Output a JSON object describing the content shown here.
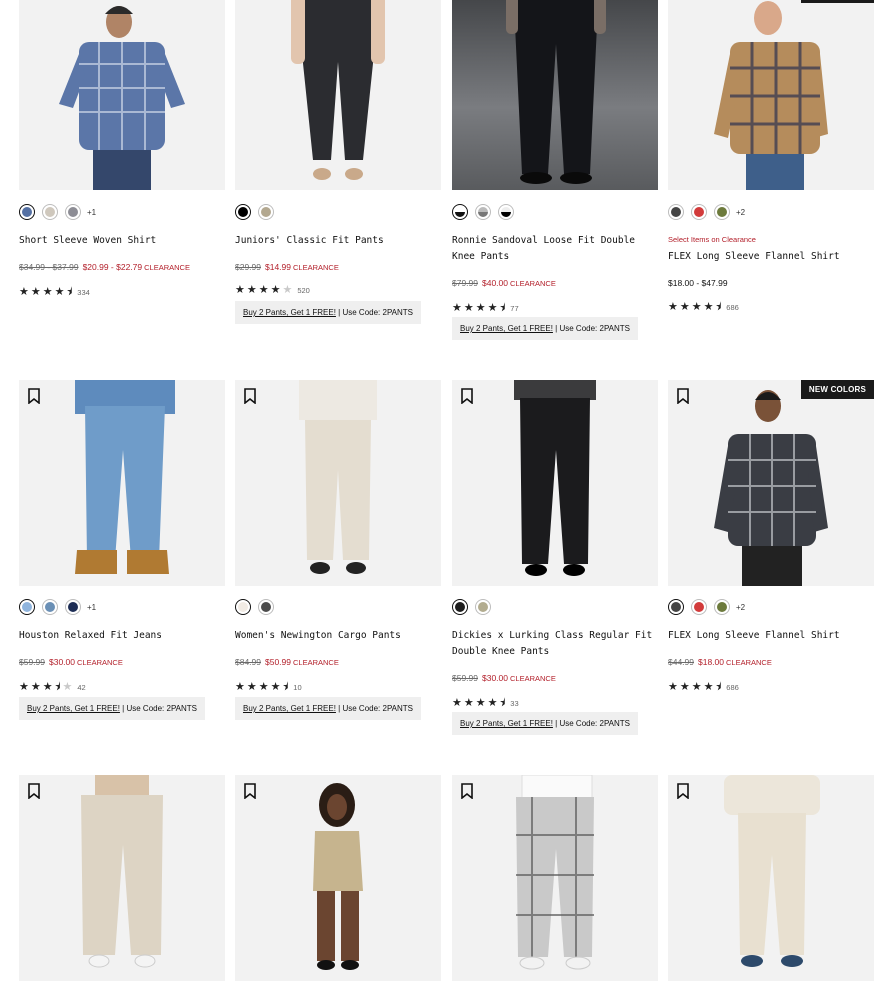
{
  "badges": {
    "new_colors": "NEW COLORS"
  },
  "offer": {
    "link": "Buy 2 Pants, Get 1 FREE!",
    "code": "Use Code: 2PANTS",
    "sep": " | "
  },
  "colors": {
    "sale": "#b3202b",
    "badge_bg": "#1a1a1a"
  },
  "row1": [
    {
      "name": "Short Sleeve Woven Shirt",
      "was": "$34.99 - $37.99",
      "sale": "$20.99 - $22.79",
      "clearance": "CLEARANCE",
      "stars": 4.5,
      "reviews": "334",
      "more": "+1"
    },
    {
      "name": "Juniors' Classic Fit Pants",
      "was": "$29.99",
      "sale": "$14.99",
      "clearance": "CLEARANCE",
      "stars": 4,
      "reviews": "520"
    },
    {
      "name": "Ronnie Sandoval Loose Fit Double Knee Pants",
      "was": "$79.99",
      "sale": "$40.00",
      "clearance": "CLEARANCE",
      "stars": 4.5,
      "reviews": "77"
    },
    {
      "name": "FLEX Long Sleeve Flannel Shirt",
      "tag": "Select Items on Clearance",
      "price": "$18.00 - $47.99",
      "stars": 4.5,
      "reviews": "686",
      "more": "+2"
    }
  ],
  "row2": [
    {
      "name": "Houston Relaxed Fit Jeans",
      "was": "$59.99",
      "sale": "$30.00",
      "clearance": "CLEARANCE",
      "stars": 3.5,
      "reviews": "42",
      "more": "+1"
    },
    {
      "name": "Women's Newington Cargo Pants",
      "was": "$84.99",
      "sale": "$50.99",
      "clearance": "CLEARANCE",
      "stars": 4.5,
      "reviews": "10"
    },
    {
      "name": "Dickies x Lurking Class Regular Fit Double Knee Pants",
      "was": "$59.99",
      "sale": "$30.00",
      "clearance": "CLEARANCE",
      "stars": 4.5,
      "reviews": "33"
    },
    {
      "name": "FLEX Long Sleeve Flannel Shirt",
      "was": "$44.99",
      "sale": "$18.00",
      "clearance": "CLEARANCE",
      "stars": 4.5,
      "reviews": "686",
      "more": "+2"
    }
  ]
}
